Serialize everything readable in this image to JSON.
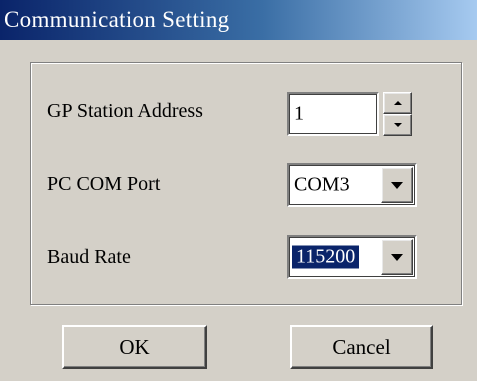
{
  "window": {
    "title": "Communication Setting"
  },
  "form": {
    "station_address": {
      "label": "GP Station Address",
      "value": "1"
    },
    "com_port": {
      "label": "PC COM Port",
      "value": "COM3"
    },
    "baud_rate": {
      "label": "Baud Rate",
      "value": "115200"
    }
  },
  "buttons": {
    "ok_label": "OK",
    "cancel_label": "Cancel"
  },
  "colors": {
    "face": "#d4d0c8",
    "title_start": "#0a246a",
    "title_end": "#a6caf0",
    "selection": "#0a246a"
  },
  "icons": {
    "spin_up": "triangle-up-icon",
    "spin_down": "triangle-down-icon",
    "dropdown": "chevron-down-icon"
  }
}
